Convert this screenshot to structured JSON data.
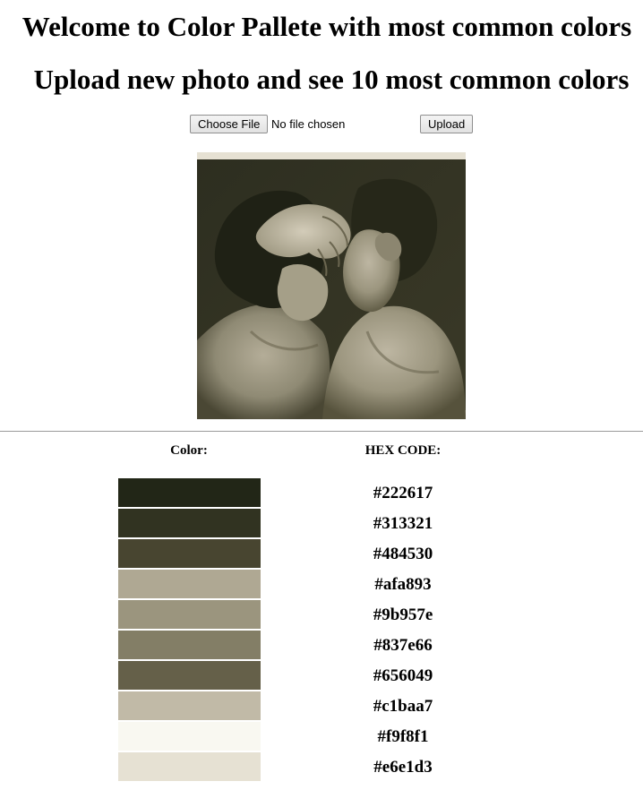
{
  "header": {
    "title": "Welcome to Color Pallete with most common colors",
    "subtitle": "Upload new photo and see 10 most common colors"
  },
  "upload": {
    "choose_label": "Choose File",
    "file_status": "No file chosen",
    "submit_label": "Upload"
  },
  "table": {
    "color_header": "Color:",
    "hex_header": "HEX CODE:"
  },
  "colors": [
    {
      "hex": "#222617"
    },
    {
      "hex": "#313321"
    },
    {
      "hex": "#484530"
    },
    {
      "hex": "#afa893"
    },
    {
      "hex": "#9b957e"
    },
    {
      "hex": "#837e66"
    },
    {
      "hex": "#656049"
    },
    {
      "hex": "#c1baa7"
    },
    {
      "hex": "#f9f8f1"
    },
    {
      "hex": "#e6e1d3"
    }
  ]
}
